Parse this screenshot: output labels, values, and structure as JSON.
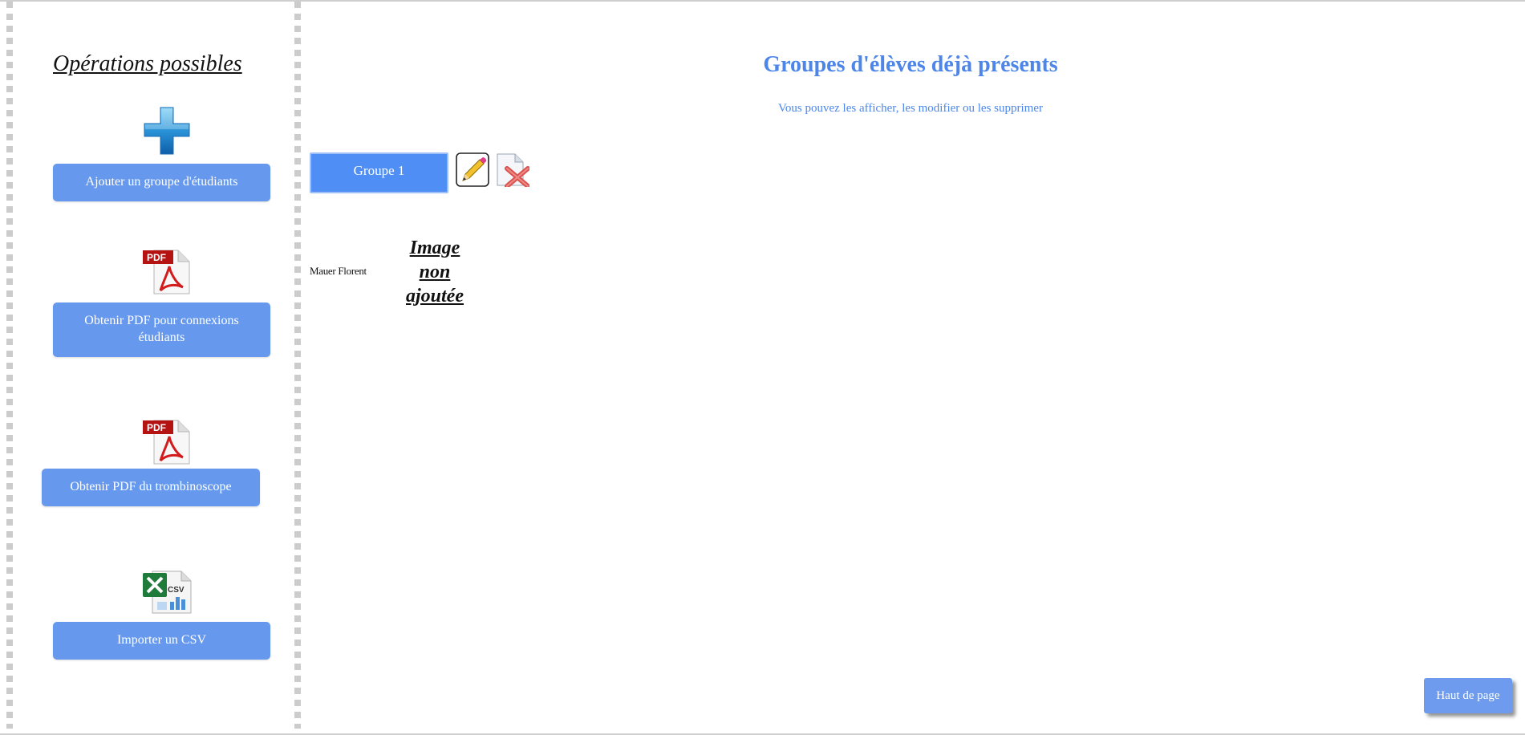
{
  "sidebar": {
    "title": "Opérations possibles",
    "operations": [
      {
        "icon": "plus-icon",
        "label": "Ajouter un groupe d'étudiants"
      },
      {
        "icon": "pdf-icon",
        "label": "Obtenir PDF pour connexions étudiants"
      },
      {
        "icon": "pdf-icon",
        "label": "Obtenir PDF du trombinoscope"
      },
      {
        "icon": "csv-icon",
        "label": "Importer un CSV"
      }
    ],
    "pdf_badge": "PDF",
    "csv_badge": "CSV"
  },
  "main": {
    "title": "Groupes d'élèves déjà présents",
    "subtitle": "Vous pouvez les afficher, les modifier ou les supprimer",
    "group": {
      "label": "Groupe 1"
    },
    "student": {
      "name": "Mauer Florent",
      "image_placeholder": "Image non ajoutée"
    }
  },
  "footer": {
    "back_to_top": "Haut de page"
  },
  "colors": {
    "accent": "#4d86e8",
    "button": "#6699ee",
    "group_button": "#4f8ff5"
  }
}
